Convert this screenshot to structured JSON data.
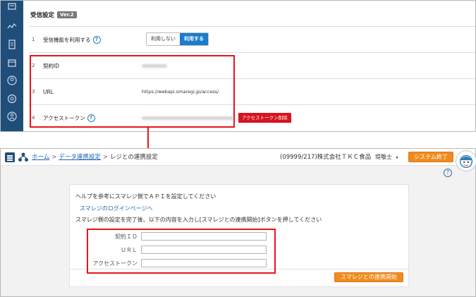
{
  "top": {
    "section_title": "受信設定",
    "version_badge": "Ver.2",
    "rows": [
      {
        "num": "1",
        "label": "受信機能を利用する"
      },
      {
        "num": "2",
        "label": "契約ID"
      },
      {
        "num": "3",
        "label": "URL",
        "value": "https://webapi.smaregi.jp/access/"
      },
      {
        "num": "4",
        "label": "アクセストークン"
      }
    ],
    "toggle": {
      "off_label": "利用しない",
      "on_label": "利用する",
      "selected": "利用する"
    },
    "delete_token_label": "アクセストークン削除",
    "help_glyph": "?"
  },
  "bottom": {
    "breadcrumb": {
      "home": "ホーム",
      "data_link": "データ連携設定",
      "current": "レジとの連携設定",
      "separator": ">"
    },
    "user_info": "(09999/217)株式会社ＴＫＣ食品",
    "user_name": "堤敬士",
    "user_menu_caret": "▾",
    "exit_label": "システム終了",
    "help_glyph": "?",
    "instructions": {
      "line1": "ヘルプを参考にスマレジ側でＡＰＩを設定してください",
      "login_link": "スマレジのログインページへ",
      "line3": "スマレジ側の設定を完了後、以下の内容を入力し[スマレジとの連携開始]ボタンを押してください"
    },
    "fields": [
      {
        "label": "契約ＩＤ",
        "value": ""
      },
      {
        "label": "ＵＲＬ",
        "value": ""
      },
      {
        "label": "アクセストークン",
        "value": ""
      }
    ],
    "start_label": "スマレジとの連携開始"
  },
  "colors": {
    "accent_blue": "#1a7ccc",
    "highlight_red": "#e8141b",
    "orange": "#f08c1e",
    "rail": "#1f4e79"
  }
}
